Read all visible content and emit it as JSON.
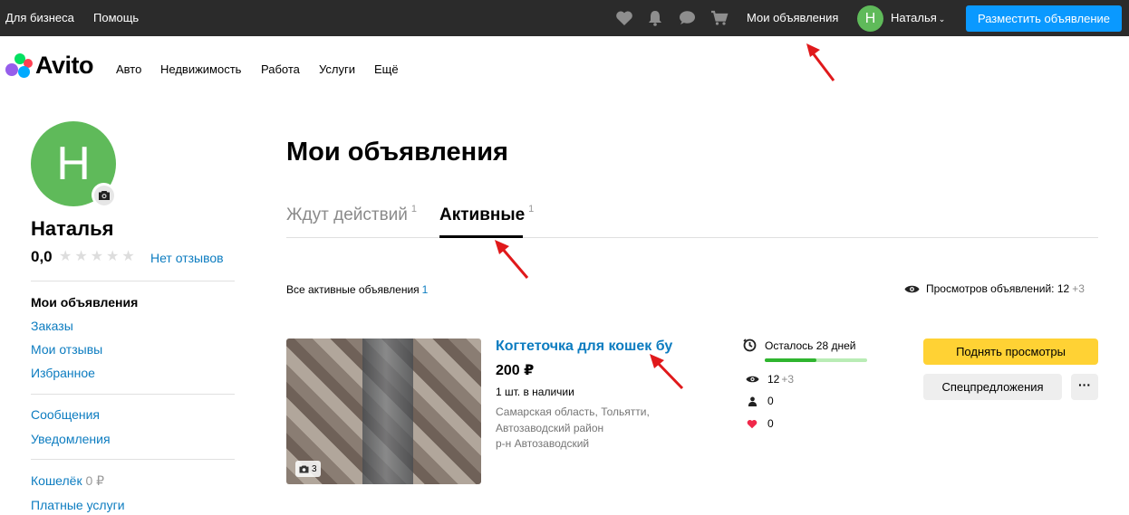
{
  "topbar": {
    "business_link": "Для бизнеса",
    "help_link": "Помощь",
    "my_ads_link": "Мои объявления",
    "avatar_letter": "Н",
    "user_name": "Наталья",
    "place_ad_button": "Разместить объявление",
    "icons": [
      "heart-icon",
      "bell-icon",
      "chat-icon",
      "cart-icon",
      "chevron-down-icon"
    ]
  },
  "logo": {
    "text": "Avito"
  },
  "nav": {
    "items": [
      "Авто",
      "Недвижимость",
      "Работа",
      "Услуги",
      "Ещё"
    ]
  },
  "profile": {
    "avatar_letter": "Н",
    "name": "Наталья",
    "rating": "0,0",
    "reviews_link": "Нет отзывов"
  },
  "sidebar": {
    "items": [
      {
        "label": "Мои объявления",
        "active": true
      },
      {
        "label": "Заказы"
      },
      {
        "label": "Мои отзывы"
      },
      {
        "label": "Избранное"
      },
      {
        "label": "Сообщения"
      },
      {
        "label": "Уведомления"
      },
      {
        "label": "Кошелёк",
        "extra": "0 ₽"
      },
      {
        "label": "Платные услуги"
      }
    ]
  },
  "main": {
    "title": "Мои объявления",
    "tabs": [
      {
        "label": "Ждут действий",
        "count": "1"
      },
      {
        "label": "Активные",
        "count": "1"
      }
    ],
    "all_active_label": "Все активные объявления",
    "all_active_count": "1",
    "views_label": "Просмотров объявлений:",
    "views_value": "12",
    "views_delta": "+3"
  },
  "listing": {
    "title": "Когтеточка для кошек бу",
    "price": "200 ₽",
    "stock": "1 шт. в наличии",
    "address": [
      "Самарская область, Тольятти,",
      "Автозаводский район",
      "р-н Автозаводский"
    ],
    "photo_count": "3",
    "days_left": "Осталось 28 дней",
    "days_progress": 0.5,
    "views": "12",
    "views_delta": "+3",
    "contacts": "0",
    "favorites": "0",
    "boost_button": "Поднять просмотры",
    "special_button": "Спецпредложения",
    "more_button": "···"
  },
  "colors": {
    "topbar_bg": "#2b2b2b",
    "primary_blue": "#0a99ff",
    "link_blue": "#0c7cc0",
    "avatar_green": "#5fba5a",
    "boost_yellow": "#ffd234",
    "progress_green": "#2fb52f",
    "annotation_red": "#e0191b"
  }
}
